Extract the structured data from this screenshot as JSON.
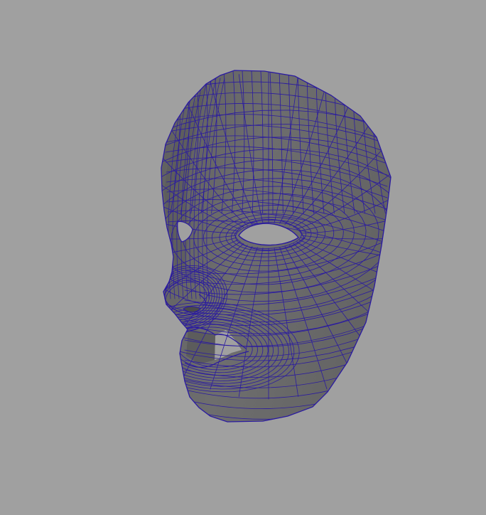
{
  "viewport": {
    "background_color": "#a0a0a0",
    "view_type": "perspective",
    "shading_mode": "wireframe-on-shaded"
  },
  "object": {
    "name_visible": "",
    "kind": "face-mask-polygon-mesh",
    "surface_color": "#6b6b6b",
    "surface_light_color": "#7a7a7a",
    "surface_dark_color": "#555555",
    "wireframe_color": "#2a1aa0",
    "features": [
      "eye-hole-right",
      "eye-hole-left",
      "nose",
      "mouth-opening",
      "lips"
    ]
  }
}
